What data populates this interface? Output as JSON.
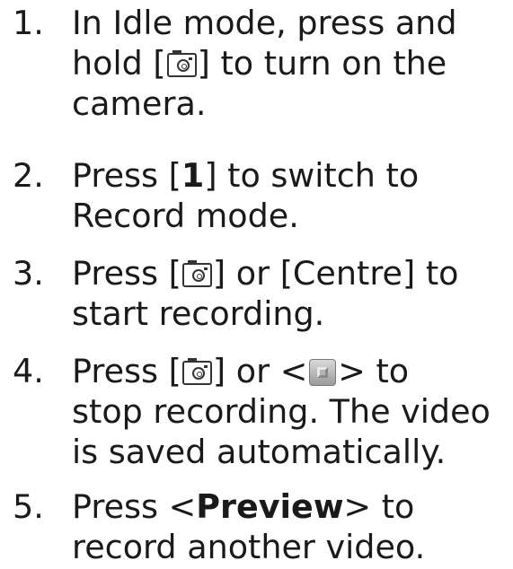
{
  "steps": [
    {
      "number": "1.",
      "lines": [
        [
          "In Idle mode, press and"
        ],
        [
          "hold [",
          "] to turn on the"
        ],
        [
          "camera."
        ]
      ],
      "icons": [
        "camera-key"
      ]
    },
    {
      "number": "2.",
      "lines": [
        [
          "Press [",
          "1",
          "] to switch to"
        ],
        [
          "Record mode."
        ]
      ]
    },
    {
      "number": "3.",
      "lines": [
        [
          "Press [",
          "] or [Centre] to"
        ],
        [
          "start recording."
        ]
      ],
      "icons": [
        "camera-key"
      ]
    },
    {
      "number": "4.",
      "lines": [
        [
          "Press [",
          "] or <",
          "> to"
        ],
        [
          "stop recording. The video"
        ],
        [
          "is saved automatically."
        ]
      ],
      "icons": [
        "camera-key",
        "stop-softkey"
      ]
    },
    {
      "number": "5.",
      "lines": [
        [
          "Press <",
          "Preview",
          "> to"
        ],
        [
          "record another video."
        ]
      ]
    }
  ]
}
